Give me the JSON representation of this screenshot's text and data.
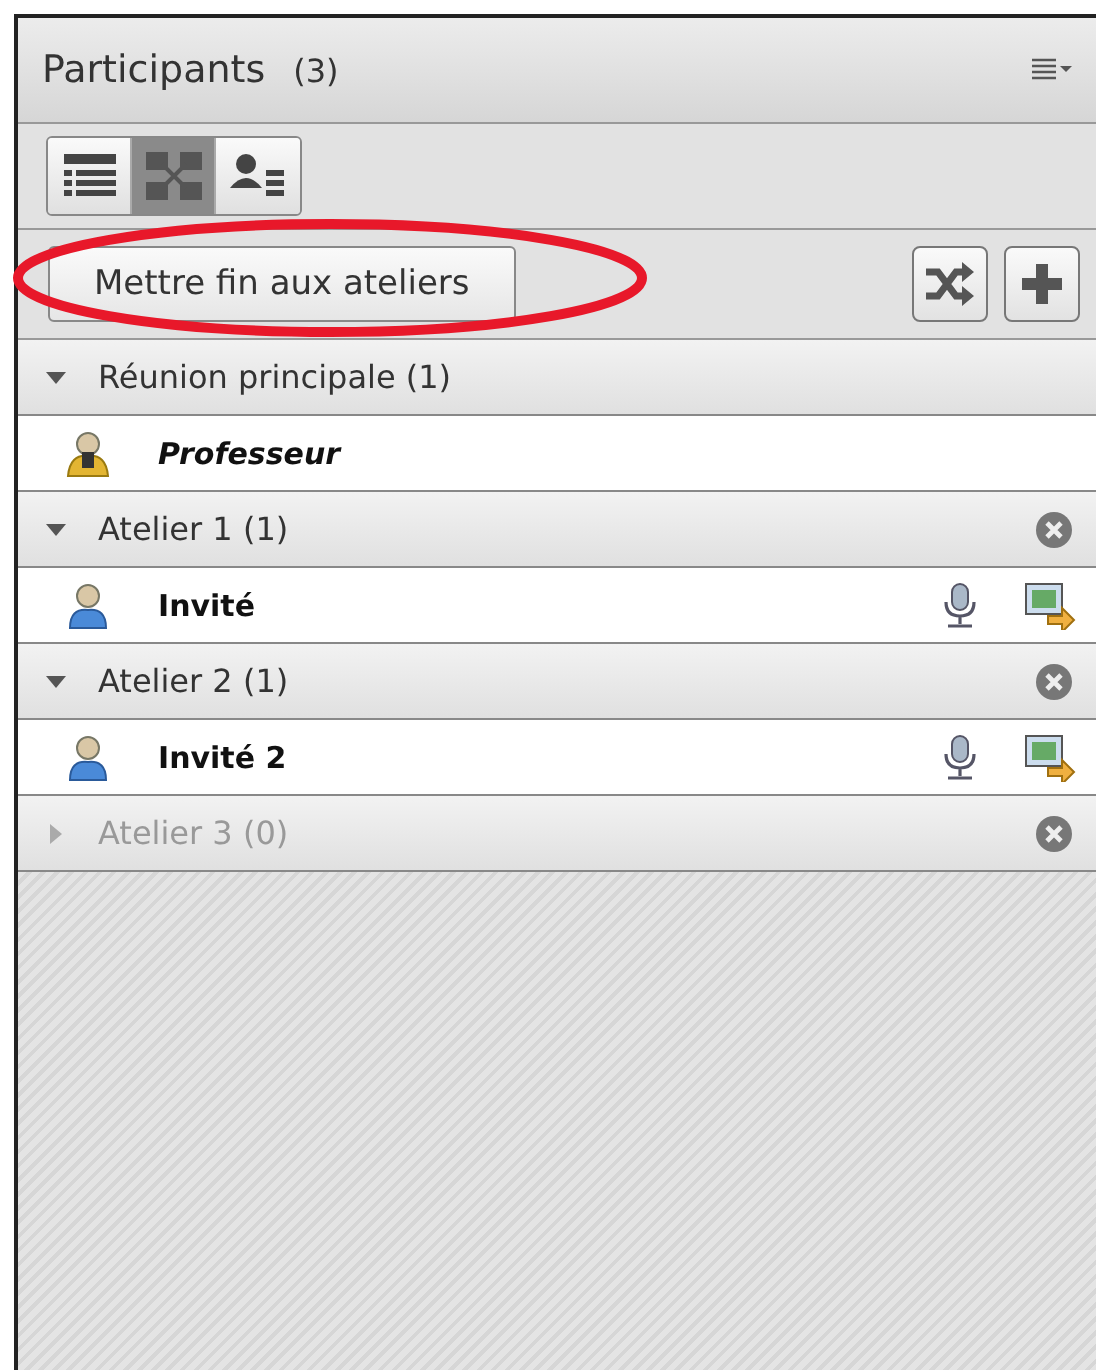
{
  "panel": {
    "title": "Participants",
    "count": "(3)"
  },
  "view_buttons": [
    {
      "kind": "list",
      "selected": false
    },
    {
      "kind": "breakout",
      "selected": true
    },
    {
      "kind": "attendee",
      "selected": false
    }
  ],
  "end_button": {
    "label": "Mettre fin aux ateliers",
    "highlighted": true
  },
  "groups": [
    {
      "title": "Réunion principale (1)",
      "expanded": true,
      "disabled": false,
      "closable": false,
      "participants": [
        {
          "name": "Professeur",
          "kind": "host",
          "mic": false,
          "share": false
        }
      ]
    },
    {
      "title": "Atelier 1 (1)",
      "expanded": true,
      "disabled": false,
      "closable": true,
      "participants": [
        {
          "name": "Invité",
          "kind": "guest",
          "mic": true,
          "share": true
        }
      ]
    },
    {
      "title": "Atelier 2 (1)",
      "expanded": true,
      "disabled": false,
      "closable": true,
      "participants": [
        {
          "name": "Invité 2",
          "kind": "guest",
          "mic": true,
          "share": true
        }
      ]
    },
    {
      "title": "Atelier 3 (0)",
      "expanded": false,
      "disabled": true,
      "closable": true
    }
  ]
}
